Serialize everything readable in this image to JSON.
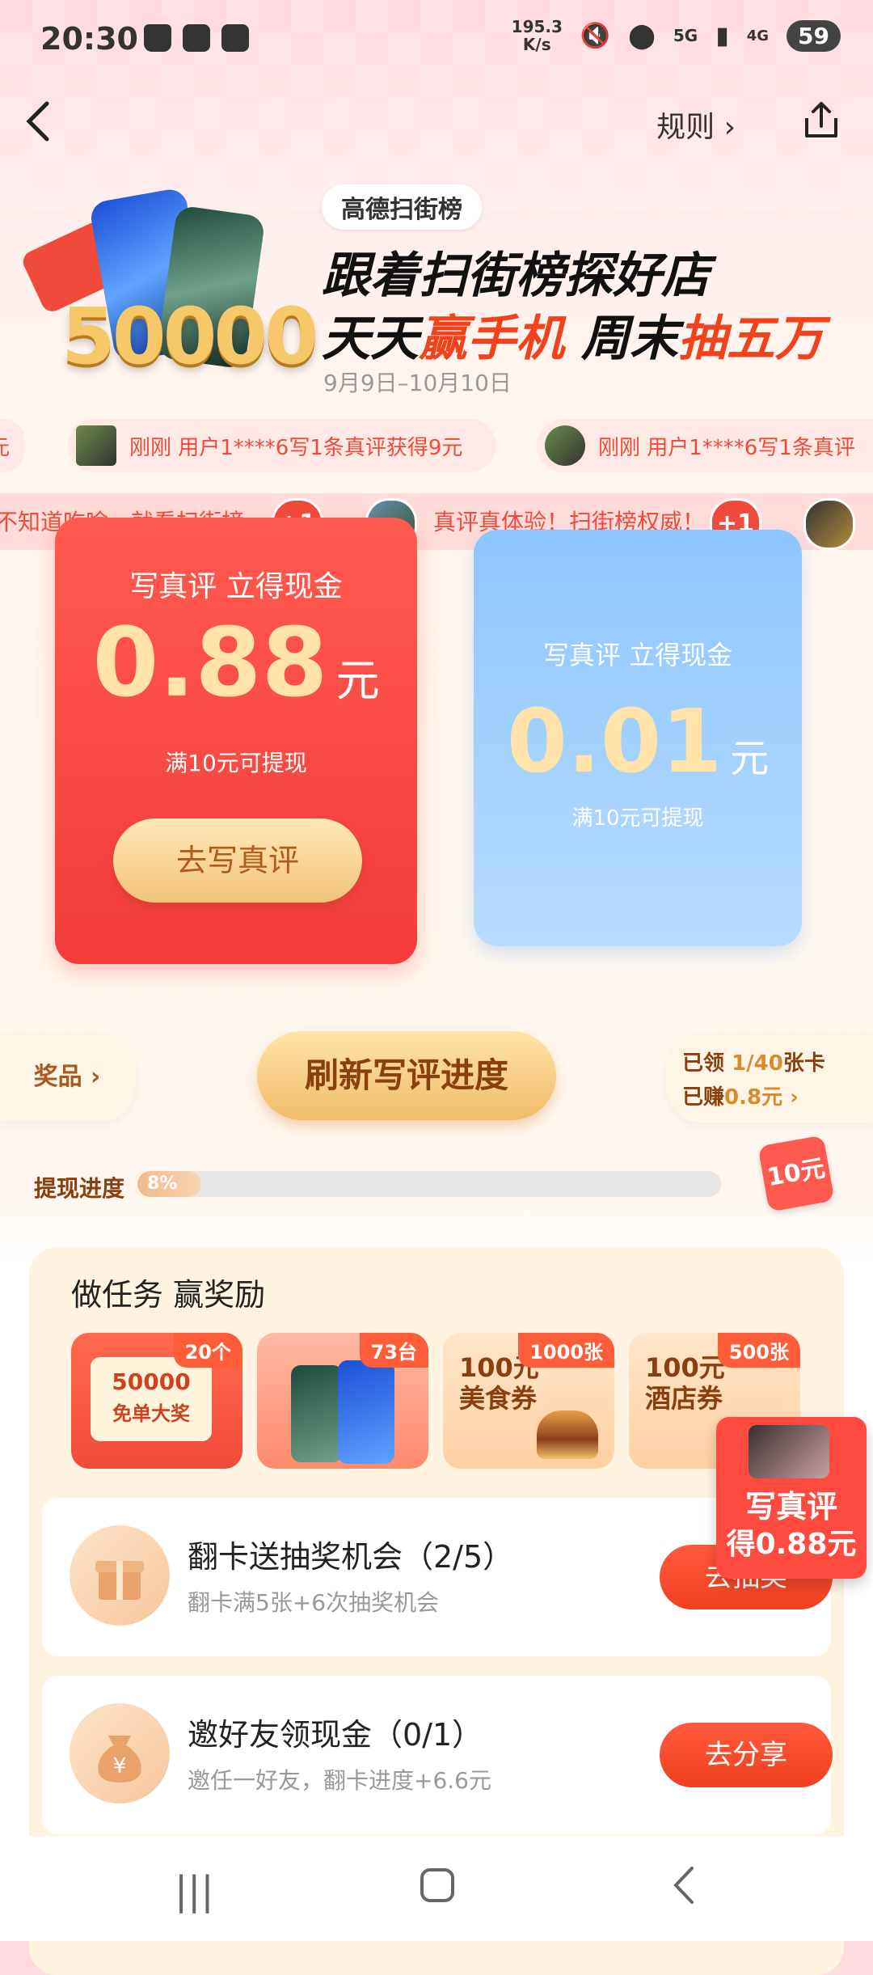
{
  "status": {
    "time": "20:30",
    "net_speed_top": "195.3",
    "net_speed_bottom": "K/s",
    "net1": "5G",
    "net2": "4G",
    "battery": "59"
  },
  "nav": {
    "rules_label": "规则 ›"
  },
  "hero": {
    "badge_number": "50000",
    "brand": "高德扫街榜",
    "line1": "跟着扫街榜探好店",
    "line2_a": "天天",
    "line2_b": "赢手机",
    "line2_c": " 周末",
    "line2_d": "抽五万",
    "date_range": "9月9日–10月10日"
  },
  "ticker1": [
    "元",
    "刚刚 用户1****6写1条真评获得9元",
    "刚刚 用户1****6写1条真评"
  ],
  "ticker2": [
    "不知道吃啥，就看扫街榜~",
    "真评真体验！扫街榜权威！"
  ],
  "plus_one": "+1",
  "card_red": {
    "title": "写真评 立得现金",
    "amount": "0.88",
    "unit": "元",
    "note": "满10元可提现",
    "button": "去写真评"
  },
  "card_blue": {
    "title": "写真评 立得现金",
    "amount": "0.01",
    "unit": "元",
    "note": "满10元可提现"
  },
  "mid": {
    "prize_tab": "奖品 ›",
    "refresh_button": "刷新写评进度",
    "earned_line1_a": "已领 ",
    "earned_line1_b": "1/40",
    "earned_line1_c": "张卡",
    "earned_line2_a": "已赚",
    "earned_line2_b": "0.8元 ›"
  },
  "progress": {
    "label": "提现进度",
    "percent_text": "8%",
    "percent": 8,
    "target_badge": "10元"
  },
  "tasks": {
    "title": "做任务 赢奖励",
    "prizes": [
      {
        "count": "20个",
        "text_a": "50000",
        "text_b": "免单大奖"
      },
      {
        "count": "73台",
        "text_a": "",
        "text_b": ""
      },
      {
        "count": "1000张",
        "text_a": "100元",
        "text_b": "美食券"
      },
      {
        "count": "500张",
        "text_a": "100元",
        "text_b": "酒店券"
      }
    ],
    "items": [
      {
        "name": "翻卡送抽奖机会（2/5）",
        "desc": "翻卡满5张+6次抽奖机会",
        "button": "去抽奖"
      },
      {
        "name": "邀好友领现金（0/1）",
        "desc": "邀任一好友，翻卡进度+6.6元",
        "button": "去分享"
      }
    ]
  },
  "float_sticker": {
    "line1": "写真评",
    "line2": "得0.88元"
  },
  "colors": {
    "accent_red": "#f04b3a",
    "gold": "#f3c57a",
    "blue_card": "#8cc6ff"
  }
}
